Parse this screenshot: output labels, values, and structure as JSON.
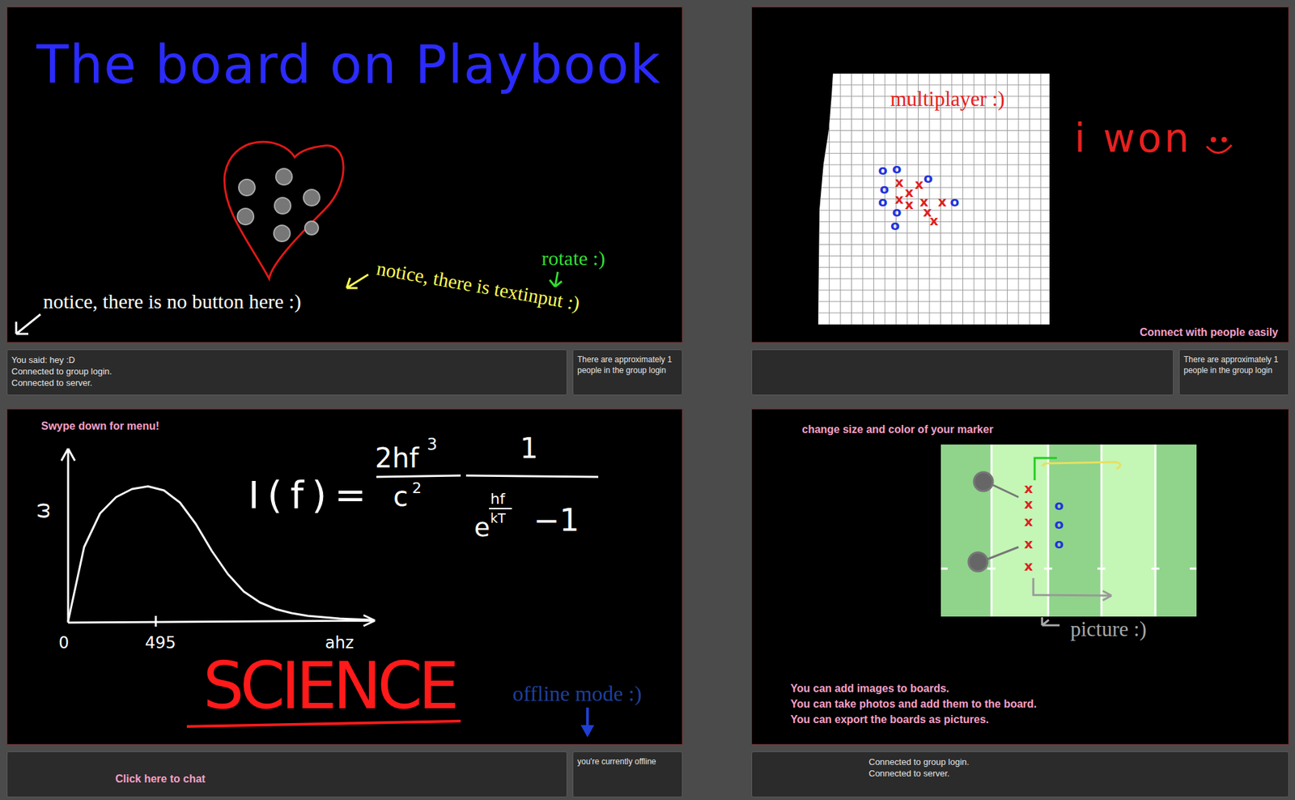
{
  "drawing_board": {
    "title": "The board on Playbook",
    "notes": [
      {
        "text": "notice, there is no button here :)",
        "color": "#ffffff"
      },
      {
        "text": "notice, there is textinput :)",
        "color": "#ffff55"
      },
      {
        "text": "rotate :)",
        "color": "#33dd33"
      }
    ],
    "chat": [
      "You said: hey :D",
      "Connected to group login.",
      "Connected to server."
    ],
    "status": "There are approximately 1 people in the group login"
  },
  "multiplayer_board": {
    "grid_label": "multiplayer :)",
    "message": "i won",
    "marks": [
      {
        "symbol": "o",
        "color": "#2233dd"
      },
      {
        "symbol": "o",
        "color": "#2233dd"
      },
      {
        "symbol": "o",
        "color": "#2233dd"
      },
      {
        "symbol": "o",
        "color": "#2233dd"
      },
      {
        "symbol": "o",
        "color": "#2233dd"
      },
      {
        "symbol": "o",
        "color": "#2233dd"
      },
      {
        "symbol": "o",
        "color": "#2233dd"
      },
      {
        "symbol": "o",
        "color": "#2233dd"
      },
      {
        "symbol": "x",
        "color": "#e02020"
      },
      {
        "symbol": "x",
        "color": "#e02020"
      },
      {
        "symbol": "x",
        "color": "#e02020"
      },
      {
        "symbol": "x",
        "color": "#e02020"
      },
      {
        "symbol": "x",
        "color": "#e02020"
      },
      {
        "symbol": "x",
        "color": "#e02020"
      },
      {
        "symbol": "x",
        "color": "#e02020"
      },
      {
        "symbol": "x",
        "color": "#e02020"
      },
      {
        "symbol": "x",
        "color": "#e02020"
      }
    ],
    "caption": "Connect with people easily",
    "status": "There are approximately 1 people in the group login"
  },
  "science_board": {
    "hint": "Swype down for menu!",
    "chart": {
      "y_label": "ω",
      "x_ticks": [
        "0",
        "495",
        "ahz"
      ],
      "series": [
        {
          "values": [
            0,
            55,
            80,
            92,
            98,
            100,
            97,
            88,
            72,
            52,
            35,
            22,
            14,
            9,
            6,
            4,
            3,
            2,
            1.5,
            1
          ]
        }
      ]
    },
    "formula": {
      "lhs": "I(f)=",
      "num1": "2hf",
      "num1_exp": "3",
      "den1": "c",
      "den1_exp": "2",
      "num2": "1",
      "den2_base": "e",
      "exp_num": "hf",
      "exp_den": "kT",
      "den2_tail": "−1"
    },
    "title": "SCIENCE",
    "mode": "offline mode :)",
    "chat_prompt": "Click here to chat",
    "status": "you're currently offline"
  },
  "picture_board": {
    "hint": "change size and color of your marker",
    "players": [
      {
        "symbol": "x",
        "color": "#e02020"
      },
      {
        "symbol": "x",
        "color": "#e02020"
      },
      {
        "symbol": "x",
        "color": "#e02020"
      },
      {
        "symbol": "x",
        "color": "#e02020"
      },
      {
        "symbol": "x",
        "color": "#e02020"
      },
      {
        "symbol": "o",
        "color": "#2233dd"
      },
      {
        "symbol": "o",
        "color": "#2233dd"
      },
      {
        "symbol": "o",
        "color": "#2233dd"
      }
    ],
    "caption": "picture :)",
    "features": [
      "You can add images to boards.",
      "You can take photos and add them to the board.",
      "You can export the boards as pictures."
    ],
    "chat": [
      "Connected to group login.",
      "Connected to server."
    ]
  }
}
